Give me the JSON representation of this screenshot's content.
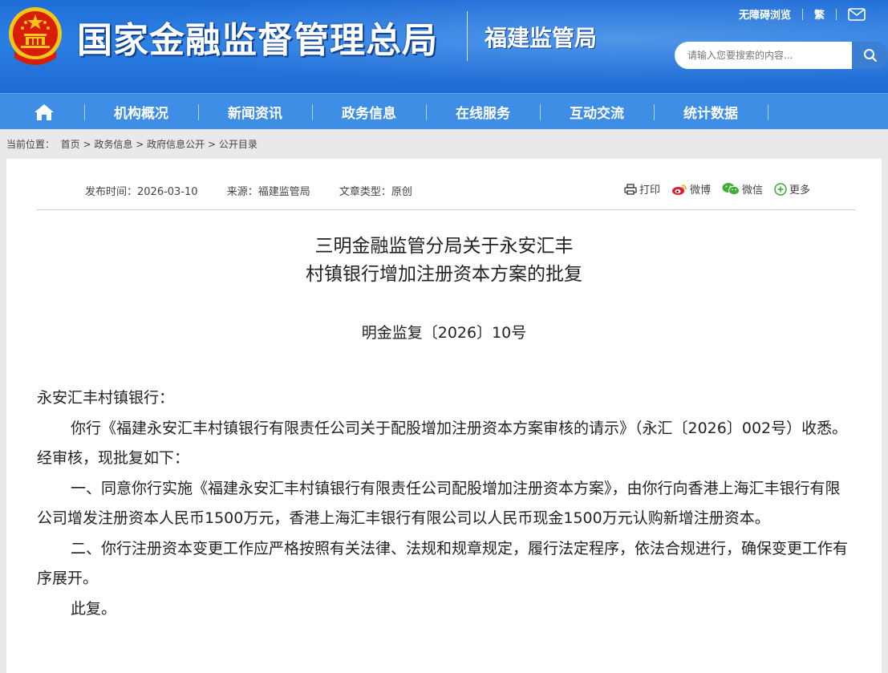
{
  "header": {
    "site_name": "国家金融监督管理总局",
    "sub_name": "福建监管局",
    "links": {
      "accessibility": "无障碍浏览",
      "traditional": "繁"
    },
    "search_placeholder": "请输入您要搜索的内容..."
  },
  "nav": {
    "items": [
      "机构概况",
      "新闻资讯",
      "政务信息",
      "在线服务",
      "互动交流",
      "统计数据"
    ]
  },
  "breadcrumb": {
    "label": "当前位置：",
    "items": [
      "首页",
      "政务信息",
      "政府信息公开",
      "公开目录"
    ],
    "separator": ">"
  },
  "meta": {
    "publish": "发布时间：2026-03-10",
    "source": "来源：福建监管局",
    "type": "文章类型：原创"
  },
  "share": {
    "print": "打印",
    "weibo": "微博",
    "wechat": "微信",
    "more": "更多"
  },
  "article": {
    "title_line1": "三明金融监管分局关于永安汇丰",
    "title_line2": "村镇银行增加注册资本方案的批复",
    "doc_no": "明金监复〔2026〕10号",
    "salutation": "永安汇丰村镇银行：",
    "para1": "你行《福建永安汇丰村镇银行有限责任公司关于配股增加注册资本方案审核的请示》（永汇〔2026〕002号）收悉。经审核，现批复如下：",
    "para2": "一、同意你行实施《福建永安汇丰村镇银行有限责任公司配股增加注册资本方案》，由你行向香港上海汇丰银行有限公司增发注册资本人民币1500万元，香港上海汇丰银行有限公司以人民币现金1500万元认购新增注册资本。",
    "para3": "二、你行注册资本变更工作应严格按照有关法律、法规和规章规定，履行法定程序，依法合规进行，确保变更工作有序展开。",
    "para4": "此复。"
  },
  "colors": {
    "header_blue": "#2a7fe3",
    "nav_blue": "#3e8ee6",
    "emblem_red": "#d81e06",
    "emblem_gold": "#f5c518"
  }
}
